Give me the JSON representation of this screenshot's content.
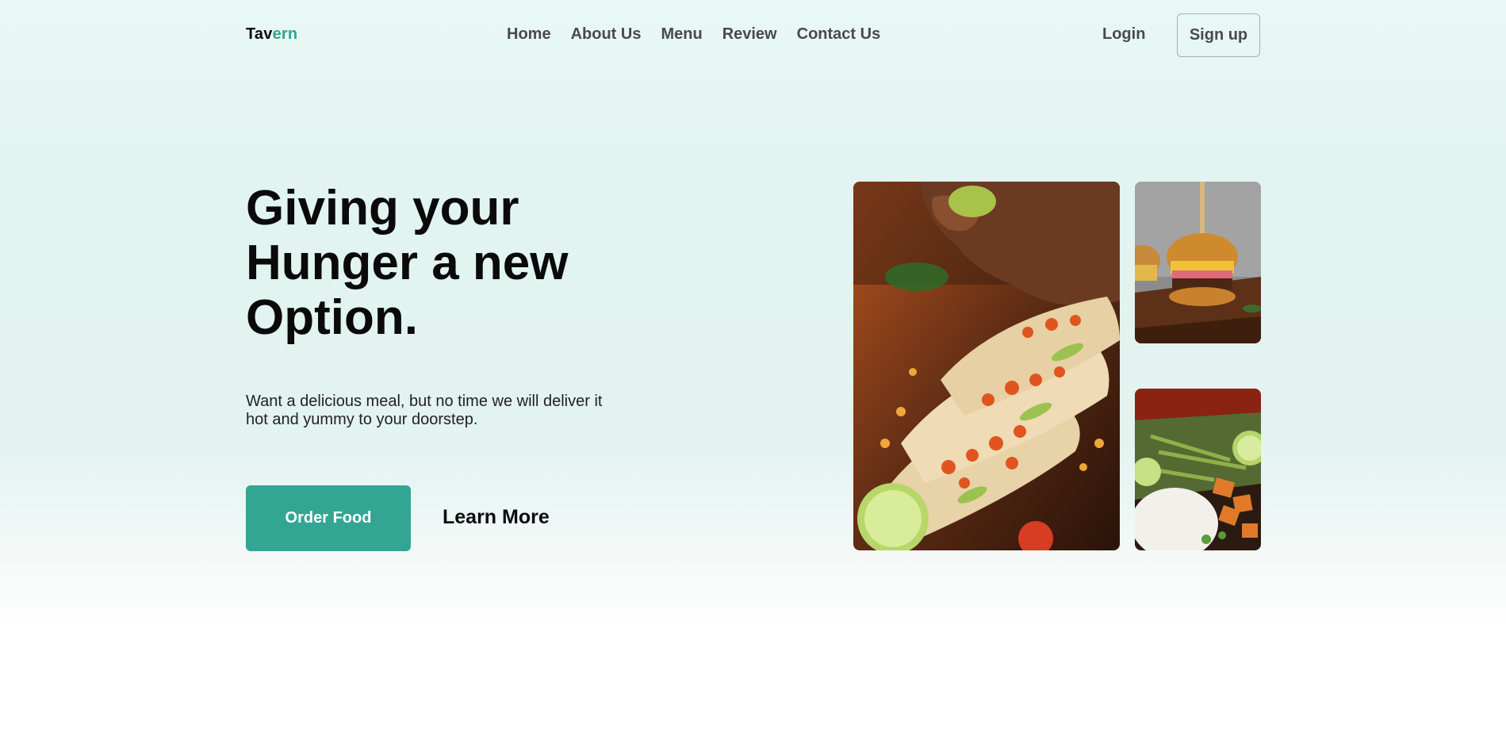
{
  "brand": {
    "part1": "Tav",
    "part2": "ern",
    "accent": "#31a592"
  },
  "nav": {
    "items": [
      "Home",
      "About Us",
      "Menu",
      "Review",
      "Contact Us"
    ]
  },
  "auth": {
    "login": "Login",
    "signup": "Sign up"
  },
  "hero": {
    "headline_line1": "Giving your",
    "headline_line2": "Hunger a new",
    "headline_line3": "Option.",
    "subtext": "Want a delicious meal, but no time we will deliver it hot and yummy to your doorstep.",
    "primary_button": "Order Food",
    "secondary_button": "Learn More",
    "primary_color": "#33a693"
  },
  "gallery": {
    "images": [
      "tacos-photo",
      "burger-photo",
      "plate-photo"
    ]
  }
}
